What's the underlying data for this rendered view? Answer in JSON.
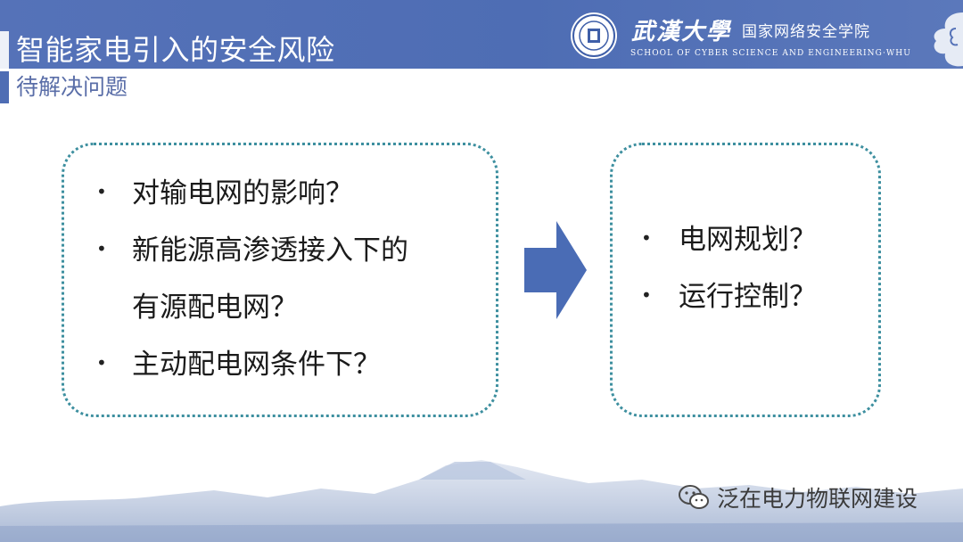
{
  "header": {
    "title": "智能家电引入的安全风险",
    "subtitle": "待解决问题",
    "school_name_calligraphy": "武漢大學",
    "college_name": "国家网络安全学院",
    "school_name_en": "SCHOOL OF CYBER SCIENCE AND ENGINEERING·WHU"
  },
  "left_box": {
    "items": [
      {
        "lines": [
          "对输电网的影响？"
        ]
      },
      {
        "lines": [
          "新能源高渗透接入下的",
          "有源配电网？"
        ]
      },
      {
        "lines": [
          "主动配电网条件下？"
        ]
      }
    ]
  },
  "right_box": {
    "items": [
      {
        "lines": [
          "电网规划？"
        ]
      },
      {
        "lines": [
          "运行控制？"
        ]
      }
    ]
  },
  "watermark": {
    "text": "泛在电力物联网建设",
    "icon": "wechat-icon"
  },
  "colors": {
    "header_blue": "#4e6db4",
    "box_border": "#3d8f9f",
    "arrow": "#4a6cb5"
  }
}
